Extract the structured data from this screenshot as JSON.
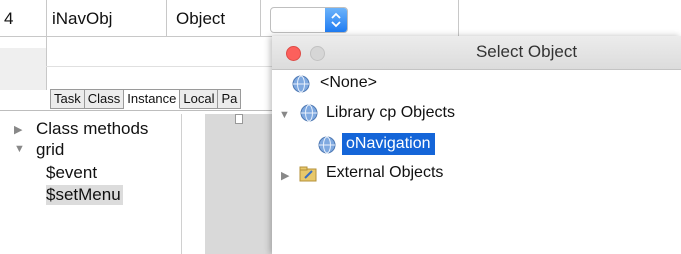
{
  "grid": {
    "row_number": "4",
    "name": "iNavObj",
    "type": "Object"
  },
  "tabs": [
    {
      "label": "Task",
      "active": false
    },
    {
      "label": "Class",
      "active": false
    },
    {
      "label": "Instance",
      "active": true
    },
    {
      "label": "Local",
      "active": false
    },
    {
      "label": "Pa",
      "active": false
    }
  ],
  "method_tree": {
    "class_methods": "Class methods",
    "grid": "grid",
    "children": [
      "$event",
      "$setMenu"
    ],
    "selected": "$setMenu"
  },
  "dialog": {
    "title": "Select Object",
    "items": [
      {
        "label": "<None>",
        "icon": "globe-icon",
        "level": 0
      },
      {
        "label": "Library cp Objects",
        "icon": "globe-icon",
        "level": 0,
        "expanded": true
      },
      {
        "label": "oNavigation",
        "icon": "globe-icon",
        "level": 1,
        "selected": true
      },
      {
        "label": "External Objects",
        "icon": "folder-icon",
        "level": 0,
        "expanded": false
      }
    ]
  },
  "colors": {
    "selection": "#1465d8",
    "traffic_red": "#fc605c",
    "traffic_gray": "#d6d6d6"
  }
}
